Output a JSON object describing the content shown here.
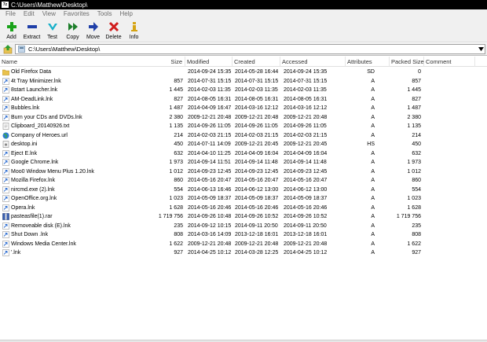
{
  "window": {
    "title": "C:\\Users\\Matthew\\Desktop\\",
    "app_icon": "7z"
  },
  "menu": [
    "File",
    "Edit",
    "View",
    "Favorites",
    "Tools",
    "Help"
  ],
  "toolbar": [
    {
      "label": "Add",
      "icon": "plus-icon",
      "color": "#1aa31a"
    },
    {
      "label": "Extract",
      "icon": "minus-icon",
      "color": "#1f3fa8"
    },
    {
      "label": "Test",
      "icon": "checkmark-icon",
      "color": "#17b0c9"
    },
    {
      "label": "Copy",
      "icon": "double-arrow-icon",
      "color": "#1c7e2a"
    },
    {
      "label": "Move",
      "icon": "arrow-right-icon",
      "color": "#1f3fa8"
    },
    {
      "label": "Delete",
      "icon": "x-icon",
      "color": "#d01c1c"
    },
    {
      "label": "Info",
      "icon": "info-icon",
      "color": "#d6a414"
    }
  ],
  "address": {
    "path": "C:\\Users\\Matthew\\Desktop\\"
  },
  "columns": {
    "name": "Name",
    "size": "Size",
    "modified": "Modified",
    "created": "Created",
    "accessed": "Accessed",
    "attributes": "Attributes",
    "packed": "Packed Size",
    "comment": "Comment"
  },
  "files": [
    {
      "icon": "folder-icon",
      "name": "Old Firefox Data",
      "size": "",
      "modified": "2014-09-24 15:35",
      "created": "2014-05-28 16:44",
      "accessed": "2014-09-24 15:35",
      "attributes": "SD",
      "packed": "0"
    },
    {
      "icon": "shortcut-icon",
      "name": "4t Tray Minimizer.lnk",
      "size": "857",
      "modified": "2014-07-31 15:15",
      "created": "2014-07-31 15:15",
      "accessed": "2014-07-31 15:15",
      "attributes": "A",
      "packed": "857"
    },
    {
      "icon": "shortcut-icon",
      "name": "8start Launcher.lnk",
      "size": "1 445",
      "modified": "2014-02-03 11:35",
      "created": "2014-02-03 11:35",
      "accessed": "2014-02-03 11:35",
      "attributes": "A",
      "packed": "1 445"
    },
    {
      "icon": "shortcut-icon",
      "name": "AM-DeadLink.lnk",
      "size": "827",
      "modified": "2014-08-05 16:31",
      "created": "2014-08-05 16:31",
      "accessed": "2014-08-05 16:31",
      "attributes": "A",
      "packed": "827"
    },
    {
      "icon": "shortcut-icon",
      "name": "Bubbles.lnk",
      "size": "1 487",
      "modified": "2014-04-09 16:47",
      "created": "2014-03-16 12:12",
      "accessed": "2014-03-16 12:12",
      "attributes": "A",
      "packed": "1 487"
    },
    {
      "icon": "shortcut-icon",
      "name": "Burn your CDs and DVDs.lnk",
      "size": "2 380",
      "modified": "2009-12-21 20:48",
      "created": "2009-12-21 20:48",
      "accessed": "2009-12-21 20:48",
      "attributes": "A",
      "packed": "2 380"
    },
    {
      "icon": "text-file-icon",
      "name": "Clipboard_20140926.txt",
      "size": "1 135",
      "modified": "2014-09-26 11:05",
      "created": "2014-09-26 11:05",
      "accessed": "2014-09-26 11:05",
      "attributes": "A",
      "packed": "1 135"
    },
    {
      "icon": "globe-icon",
      "name": "Company of Heroes.url",
      "size": "214",
      "modified": "2014-02-03 21:15",
      "created": "2014-02-03 21:15",
      "accessed": "2014-02-03 21:15",
      "attributes": "A",
      "packed": "214"
    },
    {
      "icon": "ini-file-icon",
      "name": "desktop.ini",
      "size": "450",
      "modified": "2014-07-11 14:09",
      "created": "2009-12-21 20:45",
      "accessed": "2009-12-21 20:45",
      "attributes": "HS",
      "packed": "450"
    },
    {
      "icon": "shortcut-icon",
      "name": "Eject E.lnk",
      "size": "632",
      "modified": "2014-04-10 11:25",
      "created": "2014-04-09 16:04",
      "accessed": "2014-04-09 16:04",
      "attributes": "A",
      "packed": "632"
    },
    {
      "icon": "shortcut-icon",
      "name": "Google Chrome.lnk",
      "size": "1 973",
      "modified": "2014-09-14 11:51",
      "created": "2014-09-14 11:48",
      "accessed": "2014-09-14 11:48",
      "attributes": "A",
      "packed": "1 973"
    },
    {
      "icon": "shortcut-icon",
      "name": "Moo0 Window Menu Plus 1.20.lnk",
      "size": "1 012",
      "modified": "2014-09-23 12:45",
      "created": "2014-09-23 12:45",
      "accessed": "2014-09-23 12:45",
      "attributes": "A",
      "packed": "1 012"
    },
    {
      "icon": "shortcut-icon",
      "name": "Mozilla Firefox.lnk",
      "size": "860",
      "modified": "2014-05-16 20:47",
      "created": "2014-05-16 20:47",
      "accessed": "2014-05-16 20:47",
      "attributes": "A",
      "packed": "860"
    },
    {
      "icon": "shortcut-icon",
      "name": "nircmd.exe (2).lnk",
      "size": "554",
      "modified": "2014-06-13 16:46",
      "created": "2014-06-12 13:00",
      "accessed": "2014-06-12 13:00",
      "attributes": "A",
      "packed": "554"
    },
    {
      "icon": "shortcut-icon",
      "name": "OpenOffice.org.lnk",
      "size": "1 023",
      "modified": "2014-05-09 18:37",
      "created": "2014-05-09 18:37",
      "accessed": "2014-05-09 18:37",
      "attributes": "A",
      "packed": "1 023"
    },
    {
      "icon": "shortcut-icon",
      "name": "Opera.lnk",
      "size": "1 628",
      "modified": "2014-05-16 20:46",
      "created": "2014-05-16 20:46",
      "accessed": "2014-05-16 20:46",
      "attributes": "A",
      "packed": "1 628"
    },
    {
      "icon": "archive-icon",
      "name": "pasteasfile(1).rar",
      "size": "1 719 756",
      "modified": "2014-09-26 10:48",
      "created": "2014-09-26 10:52",
      "accessed": "2014-09-26 10:52",
      "attributes": "A",
      "packed": "1 719 756"
    },
    {
      "icon": "shortcut-icon",
      "name": "Removeable disk (E).lnk",
      "size": "235",
      "modified": "2014-09-12 10:15",
      "created": "2014-09-11 20:50",
      "accessed": "2014-09-11 20:50",
      "attributes": "A",
      "packed": "235"
    },
    {
      "icon": "shortcut-icon",
      "name": "Shut Down .lnk",
      "size": "808",
      "modified": "2014-03-16 14:09",
      "created": "2013-12-18 16:01",
      "accessed": "2013-12-18 16:01",
      "attributes": "A",
      "packed": "808"
    },
    {
      "icon": "shortcut-icon",
      "name": "Windows Media Center.lnk",
      "size": "1 622",
      "modified": "2009-12-21 20:48",
      "created": "2009-12-21 20:48",
      "accessed": "2009-12-21 20:48",
      "attributes": "A",
      "packed": "1 622"
    },
    {
      "icon": "shortcut-icon",
      "name": "'.lnk",
      "size": "927",
      "modified": "2014-04-25 10:12",
      "created": "2014-03-28 12:25",
      "accessed": "2014-04-25 10:12",
      "attributes": "A",
      "packed": "927"
    }
  ]
}
